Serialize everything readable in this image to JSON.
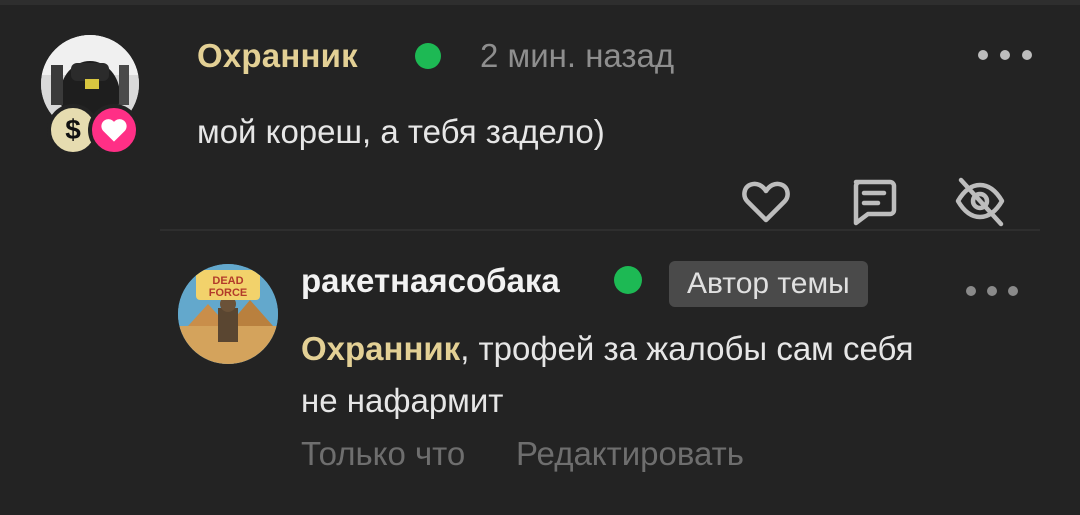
{
  "comment": {
    "author": "Охранник",
    "time": "2 мин. назад",
    "text": "мой кореш, а тебя задело)",
    "badge_dollar": "$"
  },
  "reply": {
    "author": "ракетнаясобака",
    "author_badge": "Автор темы",
    "mention": "Охранник",
    "text": ", трофей за жалобы сам себя не нафармит",
    "time": "Только что",
    "edit_label": "Редактировать",
    "avatar_text": "DEAD FORCE"
  },
  "colors": {
    "background": "#232323",
    "accent_name": "#e3d095",
    "online": "#1db954",
    "heart_badge": "#ff2f86",
    "muted": "#8e8e8e"
  },
  "icons": [
    "more-icon",
    "online-dot",
    "dollar-badge-icon",
    "heart-badge-icon",
    "heart-icon",
    "reply-icon",
    "eye-off-icon"
  ]
}
